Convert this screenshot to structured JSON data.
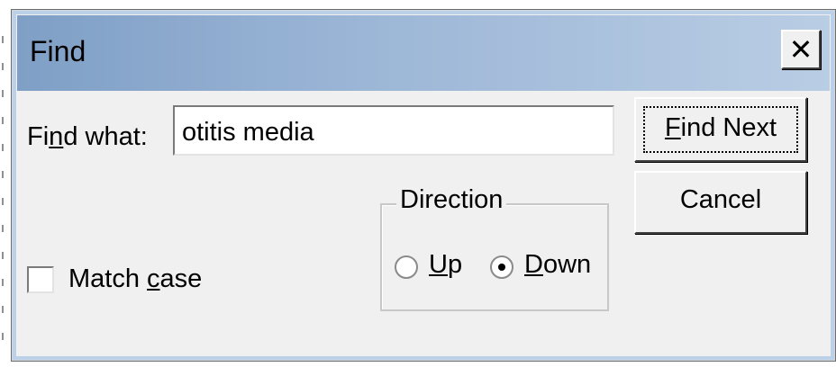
{
  "dialog": {
    "title": "Find",
    "close_symbol": "✕",
    "close_icon": "close-icon"
  },
  "find_what": {
    "label_pre": "Fi",
    "label_mnemonic": "n",
    "label_post": "d what:",
    "value": "otitis media"
  },
  "buttons": {
    "find_next_mnemonic": "F",
    "find_next_rest": "ind Next",
    "cancel": "Cancel"
  },
  "direction": {
    "legend": "Direction",
    "up_mnemonic": "U",
    "up_rest": "p",
    "down_mnemonic": "D",
    "down_rest": "own",
    "selected": "Down"
  },
  "match_case": {
    "label_pre": "Match ",
    "label_mnemonic": "c",
    "label_post": "ase",
    "checked": false
  }
}
